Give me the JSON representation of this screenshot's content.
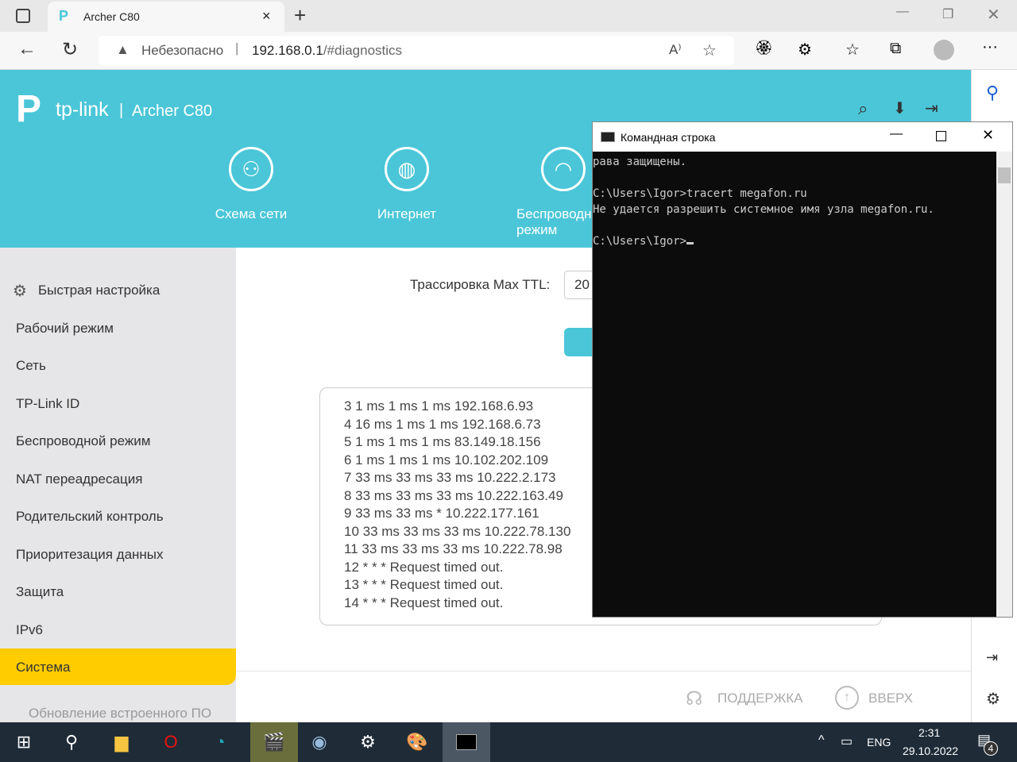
{
  "browser": {
    "tab_title": "Archer C80",
    "security": "Небезопасно",
    "url_host": "192.168.0.1",
    "url_path": "/#diagnostics"
  },
  "router": {
    "brand": "tp-link",
    "model": "Archer C80",
    "nav": [
      {
        "label": "Схема сети"
      },
      {
        "label": "Интернет"
      },
      {
        "label": "Беспроводной режим"
      }
    ],
    "sidebar": [
      "Быстрая настройка",
      "Рабочий режим",
      "Сеть",
      "TP-Link ID",
      "Беспроводной режим",
      "NAT переадресация",
      "Родительский контроль",
      "Приоритезация данных",
      "Защита",
      "IPv6",
      "Система",
      "Обновление встроенного ПО"
    ],
    "ttl_label": "Трассировка Max TTL:",
    "ttl_value": "20",
    "results": [
      "3 1 ms 1 ms 1 ms 192.168.6.93",
      "4 16 ms 1 ms 1 ms 192.168.6.73",
      "5 1 ms 1 ms 1 ms 83.149.18.156",
      "6 1 ms 1 ms 1 ms 10.102.202.109",
      "7 33 ms 33 ms 33 ms 10.222.2.173",
      "8 33 ms 33 ms 33 ms 10.222.163.49",
      "9 33 ms 33 ms * 10.222.177.161",
      "10 33 ms 33 ms 33 ms 10.222.78.130",
      "11 33 ms 33 ms 33 ms 10.222.78.98",
      "12 * * * Request timed out.",
      "13 * * * Request timed out.",
      "14 * * * Request timed out."
    ],
    "support": "ПОДДЕРЖКА",
    "top": "ВВЕРХ"
  },
  "cmd": {
    "title": "Командная строка",
    "lines": [
      "рава защищены.",
      "",
      "C:\\Users\\Igor>tracert megafon.ru",
      "Не удается разрешить системное имя узла megafon.ru.",
      "",
      "C:\\Users\\Igor>"
    ]
  },
  "taskbar": {
    "lang": "ENG",
    "time": "2:31",
    "date": "29.10.2022",
    "notifications": "4"
  }
}
